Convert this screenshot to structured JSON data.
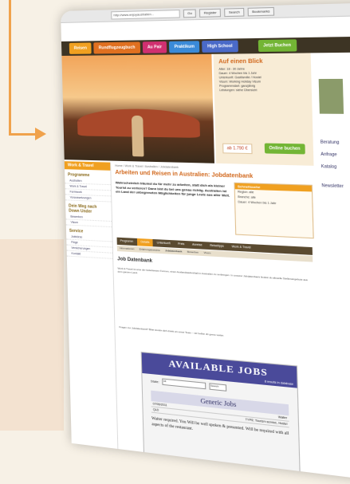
{
  "browser": {
    "url": "http://www.enjoyaustralien...",
    "buttons": [
      "Go",
      "Register",
      "Search",
      "Bookmarks"
    ]
  },
  "nav": {
    "tabs": [
      {
        "label": "Reisen",
        "color": "#f0a020"
      },
      {
        "label": "Rundflugzeugbuch",
        "color": "#e07020"
      },
      {
        "label": "Au Pair",
        "color": "#d03070"
      },
      {
        "label": "Praktikum",
        "color": "#3a8ad8"
      },
      {
        "label": "High School",
        "color": "#4a6ac8"
      },
      {
        "label": "Jetzt Buchen",
        "color": "#73b535"
      }
    ]
  },
  "offer": {
    "title": "Auf einen Blick",
    "lines": [
      "Alter: 18 - 30 Jahre",
      "Dauer: 4 Wochen bis 1 Jahr",
      "Unterkunft: Gastfamilie / Hostel",
      "Visum: Working Holiday Visum",
      "Programmstart: ganzjährig",
      "Leistungen: siehe Übersicht"
    ],
    "price": "ab 1.790 €",
    "book_label": "Online buchen"
  },
  "left": {
    "header": "Work & Travel",
    "sections": [
      {
        "title": "Programme",
        "items": [
          "Australien",
          "Work & Travel",
          "Farmwork",
          "Voraussetzungen"
        ]
      },
      {
        "title": "Dein Weg nach Down Under",
        "items": [
          "Bewerben",
          "Visum"
        ]
      },
      {
        "title": "Service",
        "items": [
          "Jobbörse",
          "Flüge",
          "Versicherungen",
          "Kontakt"
        ]
      }
    ]
  },
  "main": {
    "breadcrumb": "Home / Work & Travel / Australien / Jobdatenbank",
    "title": "Arbeiten und Reisen in Australien: Jobdatenbank",
    "intro": "Wahrscheinlich träumst du für mehr zu arbeiten, statt dich als kleiner Tourist zu verlieren? Dann bist du bei uns genau richtig. Australien ist ein Land der unbegrenzten Möglichkeiten für junge Leute aus aller Welt.",
    "sidebox_header": "Schnellsuche",
    "sidebox_lines": [
      "Region: alle",
      "Branche: alle",
      "Dauer: 4 Wochen bis 1 Jahr"
    ],
    "subtabs": [
      "Programm",
      "Details",
      "Unterkunft",
      "Preis",
      "Anreise",
      "Reisetipps",
      "Work & Travel"
    ],
    "subtabs2": [
      "Informationen",
      "Erfahrungsberichte",
      "Jobdatenbank",
      "Bewerben",
      "Visum"
    ],
    "heading": "Job Datenbank",
    "paragraphs": [
      "Work & Travel ist eine der beliebtesten Formen, einen Auslandsaufenthalt in Australien zu verbringen. In unserer Jobdatenbank findest du aktuelle Stellenangebote aus dem ganzen Land.",
      "Fragen zur Jobdatenbank? Bitte wende dich direkt an unser Team – wir helfen dir gerne weiter."
    ]
  },
  "jobs": {
    "title": "AVAILABLE JOBS",
    "subtitle": "8 results in database",
    "filter_label": "State:",
    "filter_value": "All",
    "filter_button": "Search",
    "section": "Generic Jobs",
    "row_date": "07/06/2011",
    "row_kind": "Waiter",
    "row_state": "QLD",
    "row_type": "TYPE: Tourism service, Hostel",
    "text": "Waiter required. You Will be well spoken & presented. Will be required with all aspects of the restaurant."
  },
  "right": {
    "labels": [
      "Beratung",
      "Anfrage",
      "Katalog",
      "Newsletter"
    ]
  }
}
